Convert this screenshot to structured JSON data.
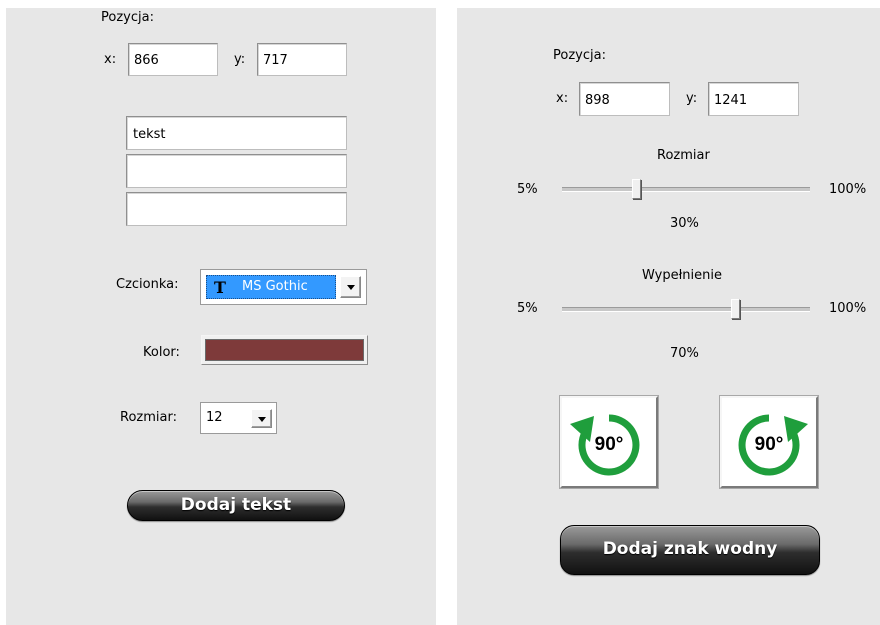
{
  "left": {
    "position_label": "Pozycja:",
    "x_label": "x:",
    "x_value": "866",
    "y_label": "y:",
    "y_value": "717",
    "text_lines": [
      "tekst",
      "",
      ""
    ],
    "font_label": "Czcionka:",
    "font_value": "MS Gothic",
    "font_icon": "truetype-font-icon",
    "font_glyph": "T",
    "color_label": "Kolor:",
    "color_swatch": "#7e3a3a",
    "size_label": "Rozmiar:",
    "size_value": "12",
    "add_text_button": "Dodaj tekst"
  },
  "right": {
    "position_label": "Pozycja:",
    "x_label": "x:",
    "x_value": "898",
    "y_label": "y:",
    "y_value": "1241",
    "size_slider": {
      "title": "Rozmiar",
      "min_label": "5%",
      "max_label": "100%",
      "value_label": "30%",
      "fraction": 0.3
    },
    "fill_slider": {
      "title": "Wypełnienie",
      "min_label": "5%",
      "max_label": "100%",
      "value_label": "70%",
      "fraction": 0.7
    },
    "rotate_left": {
      "label": "90°",
      "icon": "rotate-counterclockwise-icon"
    },
    "rotate_right": {
      "label": "90°",
      "icon": "rotate-clockwise-icon"
    },
    "add_watermark_button": "Dodaj znak wodny"
  },
  "colors": {
    "panel_bg": "#e7e7e7",
    "selection": "#3399ff",
    "rotate_arrow": "#1f9e3c"
  }
}
